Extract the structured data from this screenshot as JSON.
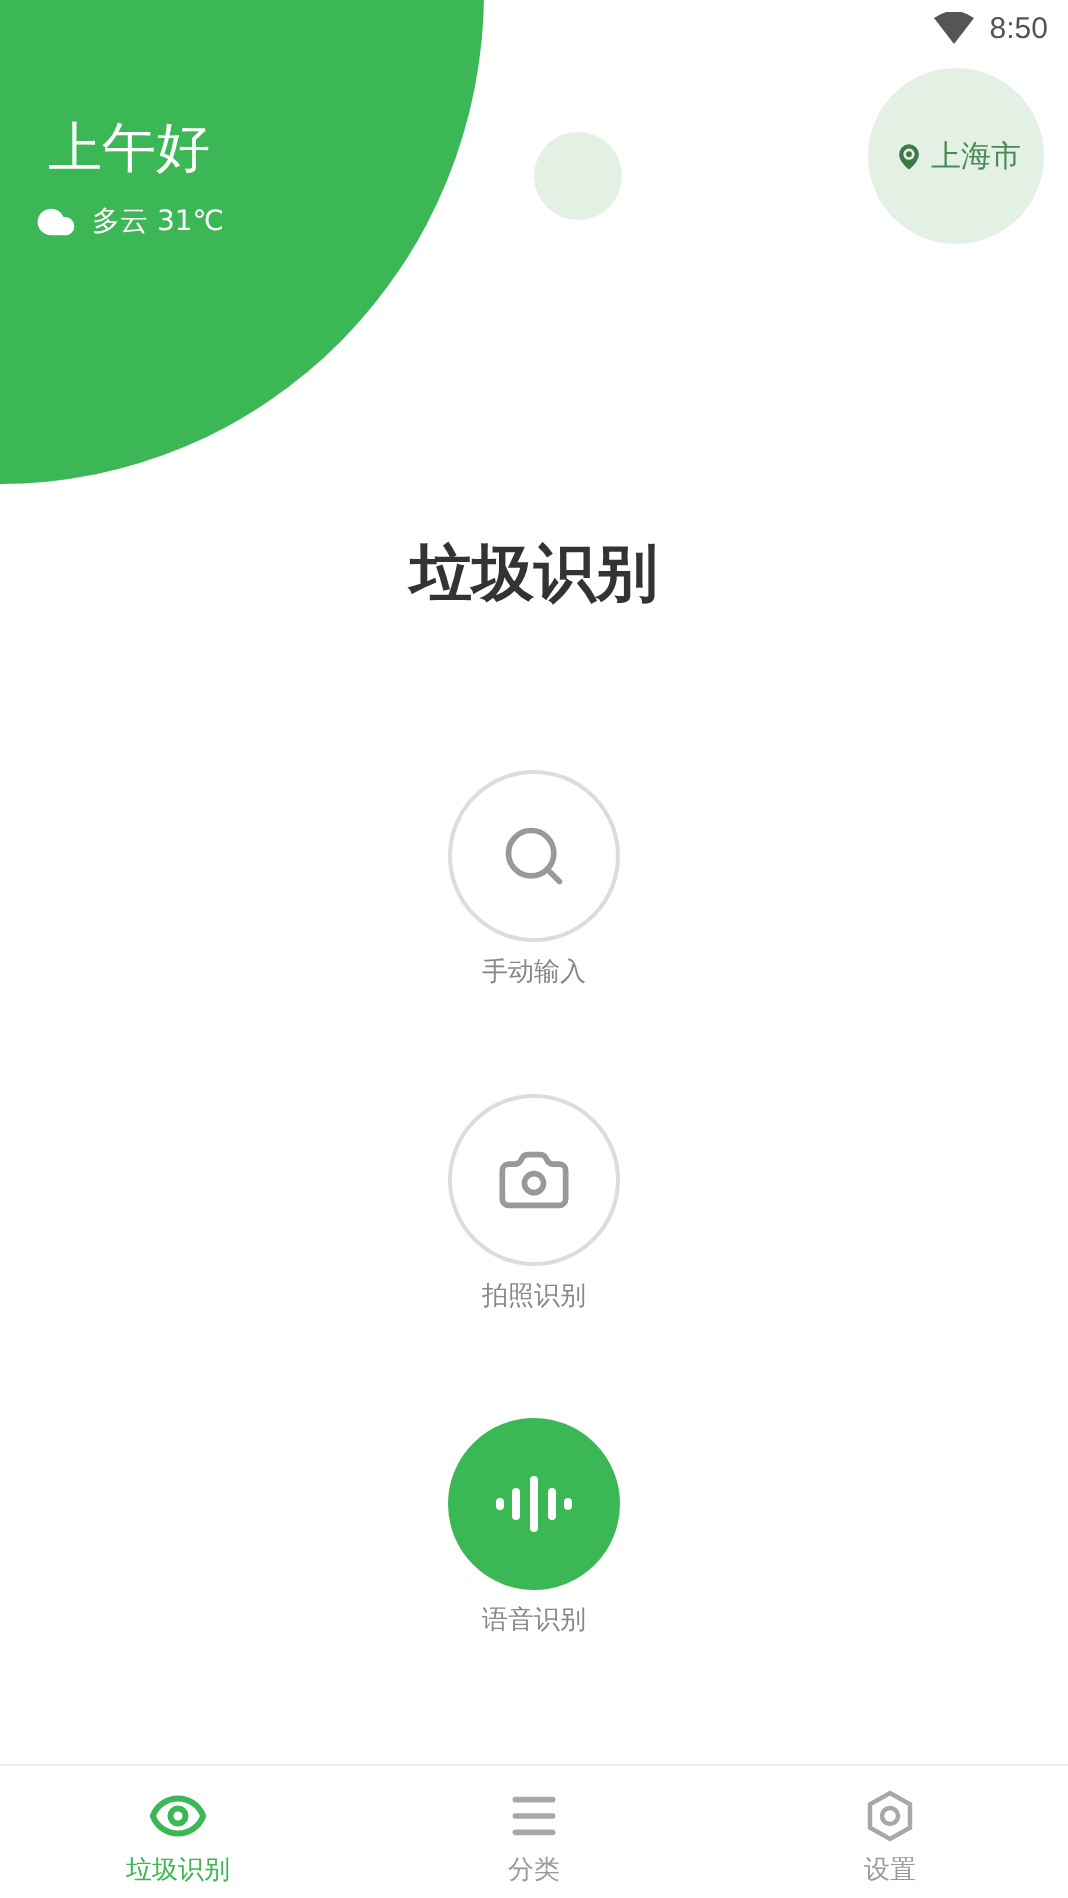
{
  "status_bar": {
    "time": "8:50"
  },
  "header": {
    "greeting": "上午好",
    "weather": "多云 31℃",
    "location": "上海市"
  },
  "title": "垃圾识别",
  "actions": [
    {
      "kind": "search",
      "label": "手动输入",
      "selected": false
    },
    {
      "kind": "camera",
      "label": "拍照识别",
      "selected": false
    },
    {
      "kind": "voice",
      "label": "语音识别",
      "selected": true
    }
  ],
  "tabs": [
    {
      "kind": "eye",
      "label": "垃圾识别",
      "selected": true
    },
    {
      "kind": "list",
      "label": "分类",
      "selected": false
    },
    {
      "kind": "settings",
      "label": "设置",
      "selected": false
    }
  ]
}
